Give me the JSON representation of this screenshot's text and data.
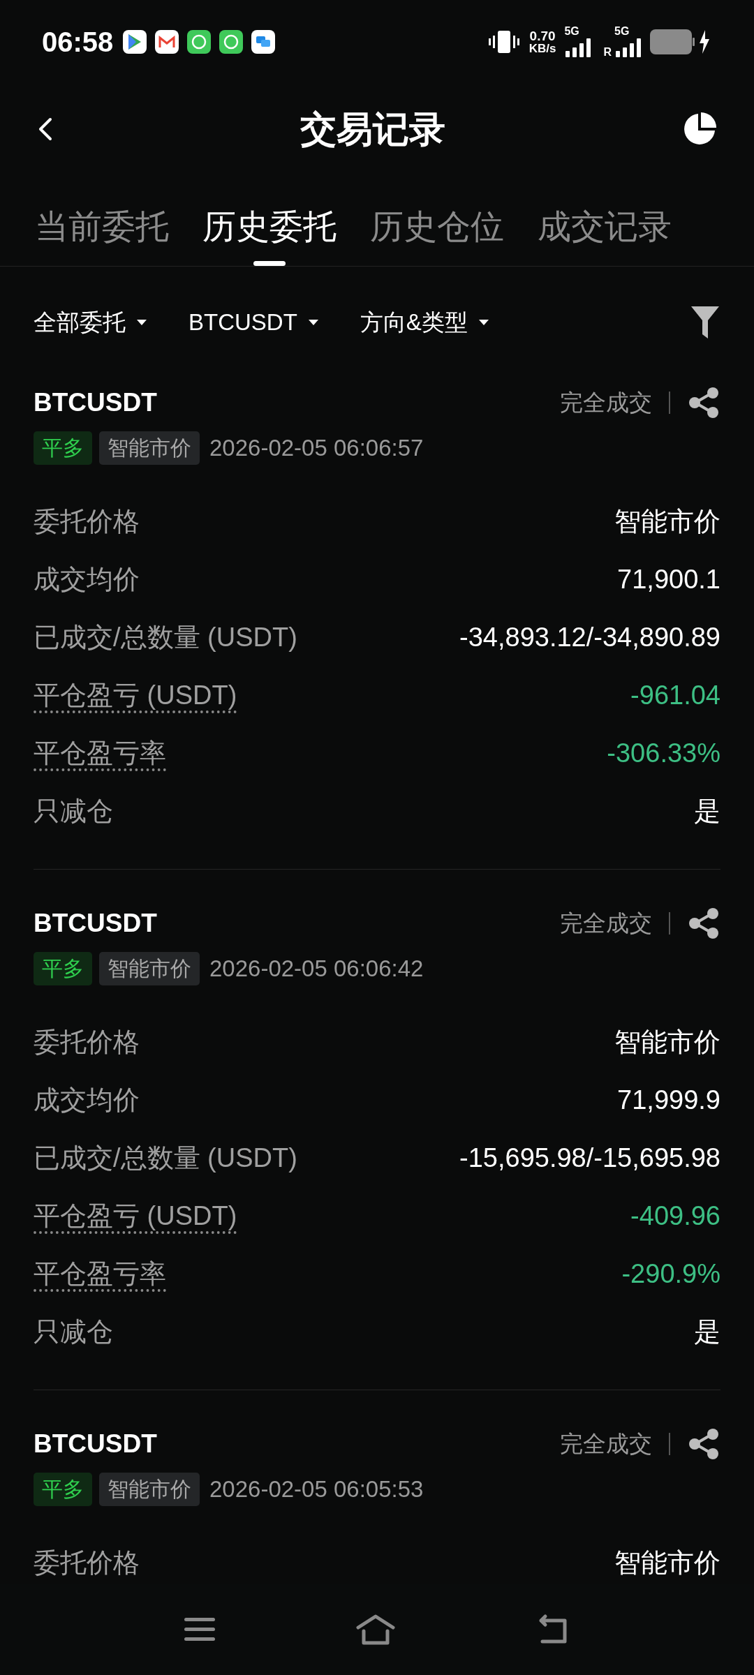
{
  "status_bar": {
    "time": "06:58",
    "net_speed": "0.70",
    "net_unit": "KB/s",
    "sim1": "5G",
    "sim2": "5G",
    "roaming": "R"
  },
  "header": {
    "title": "交易记录"
  },
  "tabs": [
    {
      "label": "当前委托",
      "selected": false
    },
    {
      "label": "历史委托",
      "selected": true
    },
    {
      "label": "历史仓位",
      "selected": false
    },
    {
      "label": "成交记录",
      "selected": false
    }
  ],
  "filters": [
    "全部委托",
    "BTCUSDT",
    "方向&类型"
  ],
  "orders": [
    {
      "symbol": "BTCUSDT",
      "status": "完全成交",
      "side": "平多",
      "type": "智能市价",
      "time": "2026-02-05 06:06:57",
      "rows": [
        {
          "label": "委托价格",
          "value": "智能市价",
          "dotted": false,
          "color": "#ffffff"
        },
        {
          "label": "成交均价",
          "value": "71,900.1",
          "dotted": false,
          "color": "#ffffff"
        },
        {
          "label": "已成交/总数量 (USDT)",
          "value": "-34,893.12/-34,890.89",
          "dotted": false,
          "color": "#ffffff"
        },
        {
          "label": "平仓盈亏 (USDT)",
          "value": "-961.04",
          "dotted": true,
          "color": "#3dbf84"
        },
        {
          "label": "平仓盈亏率",
          "value": "-306.33%",
          "dotted": true,
          "color": "#3dbf84"
        },
        {
          "label": "只减仓",
          "value": "是",
          "dotted": false,
          "color": "#ffffff"
        }
      ]
    },
    {
      "symbol": "BTCUSDT",
      "status": "完全成交",
      "side": "平多",
      "type": "智能市价",
      "time": "2026-02-05 06:06:42",
      "rows": [
        {
          "label": "委托价格",
          "value": "智能市价",
          "dotted": false,
          "color": "#ffffff"
        },
        {
          "label": "成交均价",
          "value": "71,999.9",
          "dotted": false,
          "color": "#ffffff"
        },
        {
          "label": "已成交/总数量 (USDT)",
          "value": "-15,695.98/-15,695.98",
          "dotted": false,
          "color": "#ffffff"
        },
        {
          "label": "平仓盈亏 (USDT)",
          "value": "-409.96",
          "dotted": true,
          "color": "#3dbf84"
        },
        {
          "label": "平仓盈亏率",
          "value": "-290.9%",
          "dotted": true,
          "color": "#3dbf84"
        },
        {
          "label": "只减仓",
          "value": "是",
          "dotted": false,
          "color": "#ffffff"
        }
      ]
    },
    {
      "symbol": "BTCUSDT",
      "status": "完全成交",
      "side": "平多",
      "type": "智能市价",
      "time": "2026-02-05 06:05:53",
      "rows": [
        {
          "label": "委托价格",
          "value": "智能市价",
          "dotted": false,
          "color": "#ffffff"
        }
      ]
    }
  ]
}
